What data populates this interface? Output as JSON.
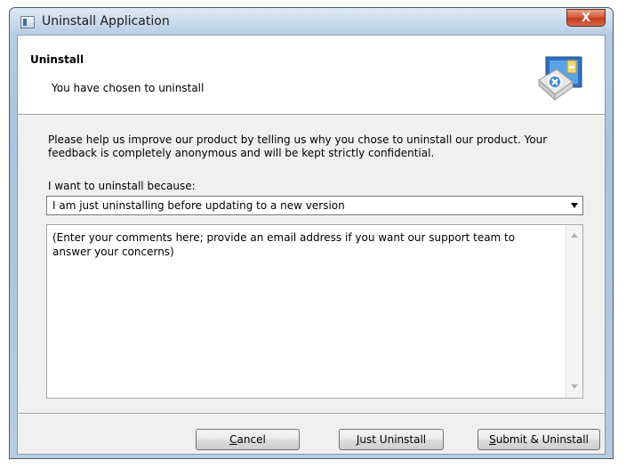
{
  "window": {
    "title": "Uninstall Application",
    "close_label": "X"
  },
  "header": {
    "title": "Uninstall",
    "subtitle": "You have chosen to uninstall"
  },
  "main": {
    "intro": "Please help us improve our product by telling us why you chose to uninstall our product. Your feedback is completely anonymous and will be kept strictly confidential.",
    "reason_label": "I want to uninstall  because:",
    "reason_selected": "I am just uninstalling before updating to a new version",
    "comments_placeholder": "(Enter your comments here; provide an email address if you want our support team to answer your concerns)"
  },
  "buttons": {
    "cancel": {
      "accel": "C",
      "rest": "ancel"
    },
    "just_uninstall": {
      "accel": "J",
      "rest": "ust Uninstall"
    },
    "submit_uninstall": {
      "accel": "S",
      "rest": "ubmit & Uninstall"
    }
  },
  "icons": {
    "app": "window-app-icon",
    "header": "uninstall-box-icon",
    "close": "close-icon"
  },
  "colors": {
    "frame": "#b9cfe6",
    "close_button": "#d65a3c",
    "dialog_bg": "#f0f0f0",
    "header_bg": "#ffffff"
  }
}
